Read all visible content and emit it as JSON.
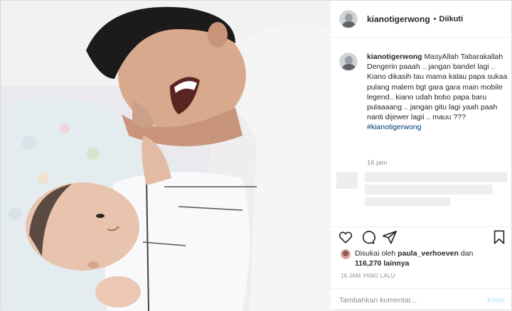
{
  "post": {
    "username": "kianotigerwong",
    "follow_dot": "•",
    "follow_status": "Diikuti"
  },
  "caption": {
    "username": "kianotigerwong",
    "text": "MasyAllah Tabarakallah Dengerin paaah .. jangan bandel lagi .. Kiano dikasih tau mama kalau papa sukaa pulang malem bgt gara gara main mobile legend.. kiano udah bobo papa baru pulaaaang .. jangan gitu lagi yaah paah nanti dijewer lagii .. mauu ???",
    "hashtag": "#kianotigerwong",
    "time": "16 jam"
  },
  "actions": {
    "like_icon": "heart-icon",
    "comment_icon": "comment-icon",
    "share_icon": "share-icon",
    "save_icon": "bookmark-icon"
  },
  "likes": {
    "prefix": "Disukai oleh",
    "liker": "paula_verhoeven",
    "middle": "dan",
    "count": "116,270",
    "suffix": "lainnya"
  },
  "timestamp": "16 JAM YANG LALU",
  "comment": {
    "placeholder": "Tambahkan komentar...",
    "post_label": "Kirim"
  },
  "colors": {
    "border": "#dbdbdb",
    "hashtag": "#00376b",
    "muted": "#8e8e8e",
    "post_disabled": "#b2dffc"
  }
}
